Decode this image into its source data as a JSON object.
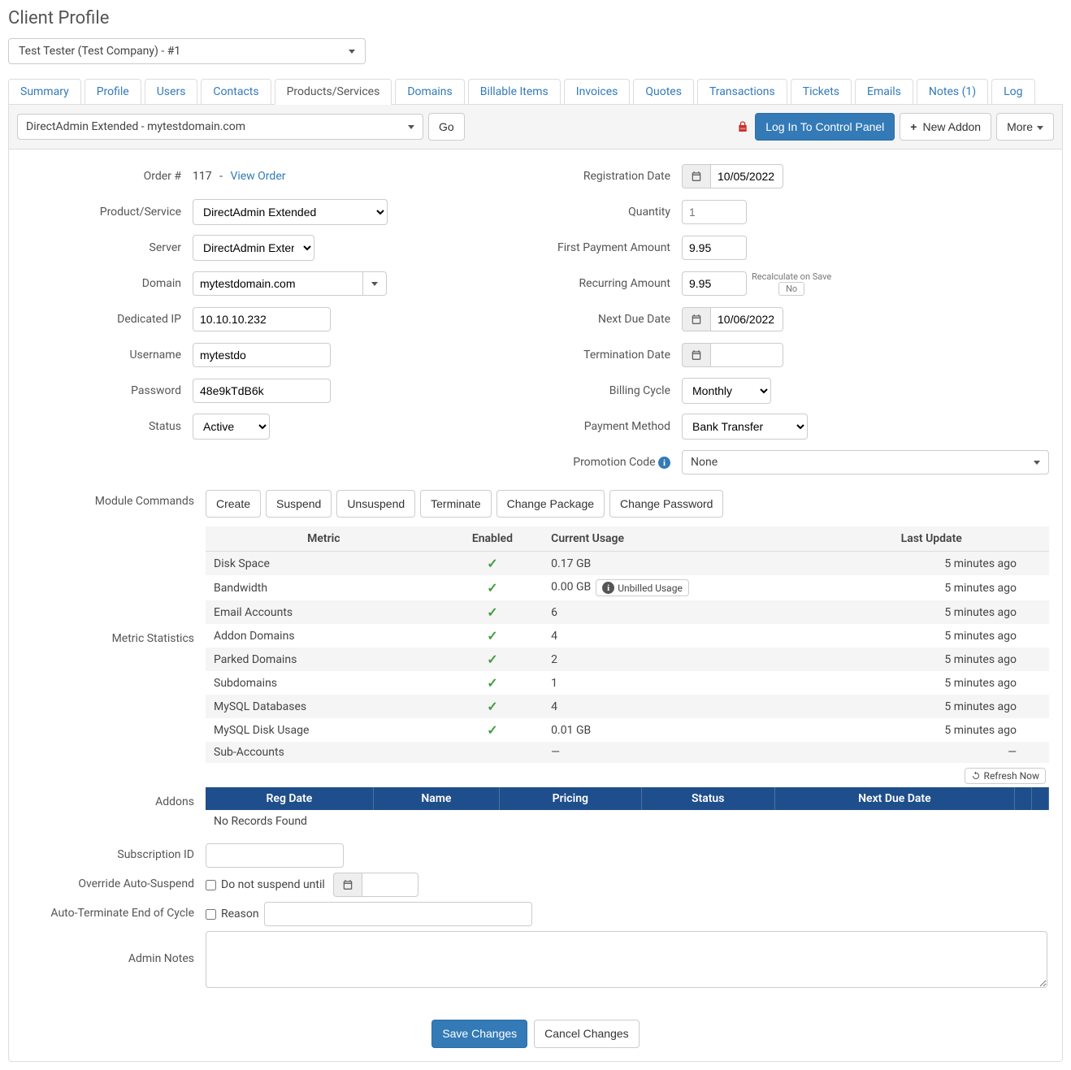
{
  "page_title": "Client Profile",
  "client_selector": "Test Tester (Test Company) - #1",
  "tabs": {
    "summary": "Summary",
    "profile": "Profile",
    "users": "Users",
    "contacts": "Contacts",
    "products": "Products/Services",
    "domains": "Domains",
    "billable": "Billable Items",
    "invoices": "Invoices",
    "quotes": "Quotes",
    "transactions": "Transactions",
    "tickets": "Tickets",
    "emails": "Emails",
    "notes": "Notes (1)",
    "log": "Log"
  },
  "toolbar": {
    "product_dropdown": "DirectAdmin Extended - mytestdomain.com",
    "go": "Go",
    "login_cp": "Log In To Control Panel",
    "new_addon": "New Addon",
    "more": "More"
  },
  "left_fields": {
    "order_label": "Order #",
    "order_id": "117",
    "view_order": "View Order",
    "product_label": "Product/Service",
    "product_value": "DirectAdmin Extended",
    "server_label": "Server",
    "server_value": "DirectAdmin Extended",
    "domain_label": "Domain",
    "domain_value": "mytestdomain.com",
    "dedip_label": "Dedicated IP",
    "dedip_value": "10.10.10.232",
    "username_label": "Username",
    "username_value": "mytestdo",
    "password_label": "Password",
    "password_value": "48e9kTdB6k",
    "status_label": "Status",
    "status_value": "Active"
  },
  "right_fields": {
    "regdate_label": "Registration Date",
    "regdate_value": "10/05/2022",
    "qty_label": "Quantity",
    "qty_value": "1",
    "first_pay_label": "First Payment Amount",
    "first_pay_value": "9.95",
    "recurring_label": "Recurring Amount",
    "recurring_value": "9.95",
    "recalc_label": "Recalculate on Save",
    "recalc_toggle": "No",
    "nextdue_label": "Next Due Date",
    "nextdue_value": "10/06/2022",
    "termdate_label": "Termination Date",
    "termdate_value": "",
    "billing_label": "Billing Cycle",
    "billing_value": "Monthly",
    "payment_label": "Payment Method",
    "payment_value": "Bank Transfer",
    "promo_label": "Promotion Code",
    "promo_value": "None"
  },
  "module_commands": {
    "label": "Module Commands",
    "create": "Create",
    "suspend": "Suspend",
    "unsuspend": "Unsuspend",
    "terminate": "Terminate",
    "change_package": "Change Package",
    "change_password": "Change Password"
  },
  "metrics": {
    "label": "Metric Statistics",
    "headers": {
      "metric": "Metric",
      "enabled": "Enabled",
      "usage": "Current Usage",
      "updated": "Last Update"
    },
    "rows": [
      {
        "metric": "Disk Space",
        "enabled": true,
        "usage": "0.17 GB",
        "updated": "5 minutes ago"
      },
      {
        "metric": "Bandwidth",
        "enabled": true,
        "usage": "0.00 GB",
        "has_unbilled": true,
        "unbilled_label": "Unbilled Usage",
        "updated": "5 minutes ago"
      },
      {
        "metric": "Email Accounts",
        "enabled": true,
        "usage": "6",
        "updated": "5 minutes ago"
      },
      {
        "metric": "Addon Domains",
        "enabled": true,
        "usage": "4",
        "updated": "5 minutes ago"
      },
      {
        "metric": "Parked Domains",
        "enabled": true,
        "usage": "2",
        "updated": "5 minutes ago"
      },
      {
        "metric": "Subdomains",
        "enabled": true,
        "usage": "1",
        "updated": "5 minutes ago"
      },
      {
        "metric": "MySQL Databases",
        "enabled": true,
        "usage": "4",
        "updated": "5 minutes ago"
      },
      {
        "metric": "MySQL Disk Usage",
        "enabled": true,
        "usage": "0.01 GB",
        "updated": "5 minutes ago"
      },
      {
        "metric": "Sub-Accounts",
        "enabled": false,
        "usage": "—",
        "updated": "—"
      }
    ],
    "refresh": "Refresh Now"
  },
  "addons": {
    "label": "Addons",
    "headers": {
      "regdate": "Reg Date",
      "name": "Name",
      "pricing": "Pricing",
      "status": "Status",
      "nextdue": "Next Due Date"
    },
    "empty": "No Records Found"
  },
  "lower": {
    "subscription_label": "Subscription ID",
    "subscription_value": "",
    "override_label": "Override Auto-Suspend",
    "override_text": "Do not suspend until",
    "autoterm_label": "Auto-Terminate End of Cycle",
    "autoterm_text": "Reason",
    "notes_label": "Admin Notes",
    "notes_value": ""
  },
  "footer": {
    "save": "Save Changes",
    "cancel": "Cancel Changes"
  }
}
